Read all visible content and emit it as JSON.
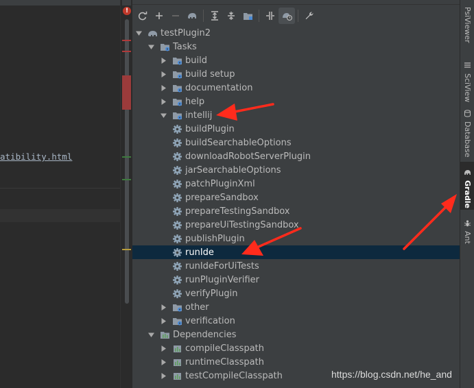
{
  "editor": {
    "code_fragment": "atibility.html"
  },
  "gutter": {
    "error_badge": "!"
  },
  "toolbar": {
    "buttons": [
      {
        "name": "refresh-icon"
      },
      {
        "name": "plus-icon"
      },
      {
        "name": "minus-icon"
      },
      {
        "name": "elephant-icon"
      },
      {
        "name": "expand-all-icon"
      },
      {
        "name": "collapse-all-icon"
      },
      {
        "name": "folder-icon"
      },
      {
        "name": "toggle-offline-icon"
      },
      {
        "name": "schedule-icon"
      },
      {
        "name": "wrench-icon"
      }
    ]
  },
  "tree": {
    "project": "testPlugin2",
    "tasks_label": "Tasks",
    "task_groups": [
      "build",
      "build setup",
      "documentation",
      "help"
    ],
    "intellij_group": "intellij",
    "intellij_tasks": [
      "buildPlugin",
      "buildSearchableOptions",
      "downloadRobotServerPlugin",
      "jarSearchableOptions",
      "patchPluginXml",
      "prepareSandbox",
      "prepareTestingSandbox",
      "prepareUiTestingSandbox",
      "publishPlugin",
      "runIde",
      "runIdeForUiTests",
      "runPluginVerifier",
      "verifyPlugin"
    ],
    "selected_task": "runIde",
    "other_groups": [
      "other",
      "verification"
    ],
    "dependencies_label": "Dependencies",
    "dependency_items": [
      "compileClasspath",
      "runtimeClasspath",
      "testCompileClasspath"
    ]
  },
  "side_strip": {
    "tabs": [
      "PsiViewer",
      "SciView",
      "Database",
      "Gradle",
      "Ant"
    ],
    "active_tab": "Gradle"
  },
  "watermark": "https://blog.csdn.net/he_and",
  "colors": {
    "panel_bg": "#3c3f41",
    "editor_bg": "#2b2b2b",
    "selection": "#0d293e",
    "annotation_arrow": "#ff2b1c",
    "gear": "#8ea3b5",
    "folder": "#8f9aa6",
    "dependency_bars": "#5f9e5f"
  }
}
